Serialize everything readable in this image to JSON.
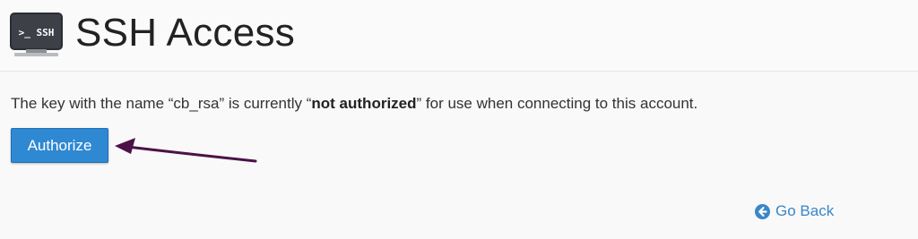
{
  "header": {
    "title": "SSH Access",
    "icon": "terminal-icon",
    "icon_text": ">_ SSH"
  },
  "message": {
    "prefix": "The key with the name “cb_rsa” is currently “",
    "status": "not authorized",
    "suffix": "” for use when connecting to this account."
  },
  "actions": {
    "authorize_label": "Authorize",
    "go_back_label": "Go Back",
    "go_back_icon": "arrow-circle-left-icon"
  },
  "colors": {
    "primary": "#2f88d2",
    "link": "#3a86c8",
    "annotation_arrow": "#4b1248"
  }
}
